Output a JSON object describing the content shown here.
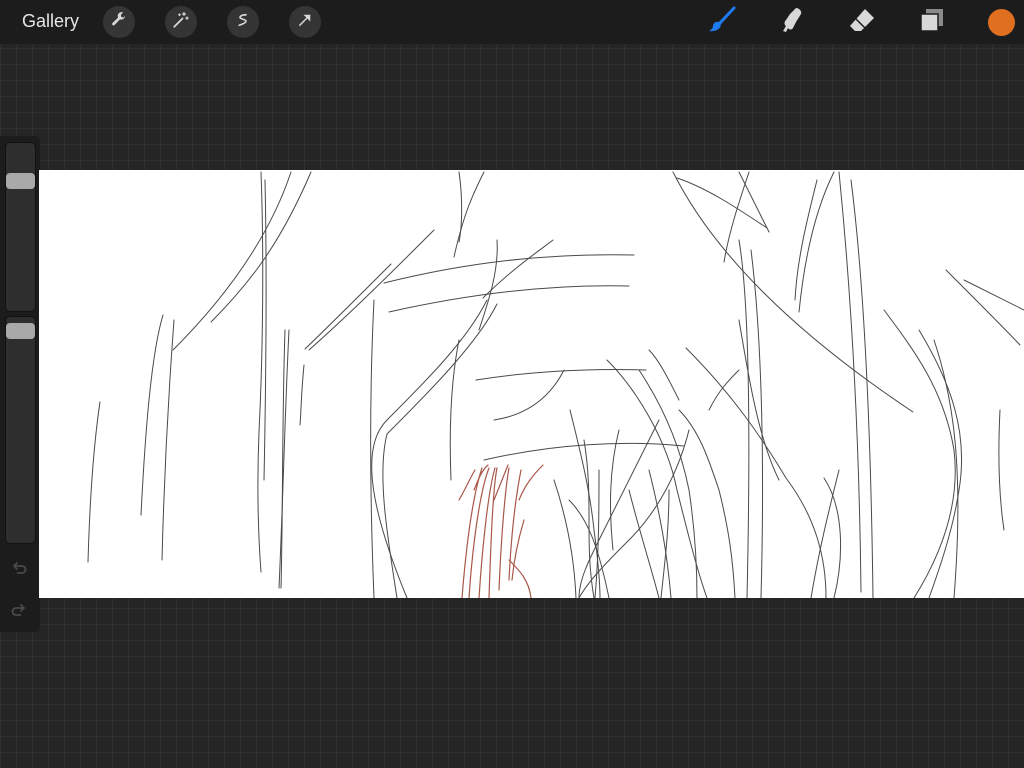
{
  "toolbar": {
    "gallery_label": "Gallery",
    "left_tools": [
      "wrench-icon",
      "magic-wand-icon",
      "selection-icon",
      "transform-arrow-icon"
    ],
    "right_tools": [
      "brush-icon",
      "smudge-icon",
      "eraser-icon",
      "layers-icon"
    ],
    "active_tool": "brush",
    "active_color": "#e07020"
  },
  "sidebar": {
    "brush_size": 0.8,
    "opacity": 0.97,
    "undo": "undo-icon",
    "redo": "redo-icon"
  },
  "colors": {
    "toolbar_bg": "#1c1c1c",
    "workspace_bg": "#252525",
    "active_brush": "#1e7bf0",
    "sketch_stroke": "#222222",
    "hair_stroke": "#9b3a2a"
  }
}
